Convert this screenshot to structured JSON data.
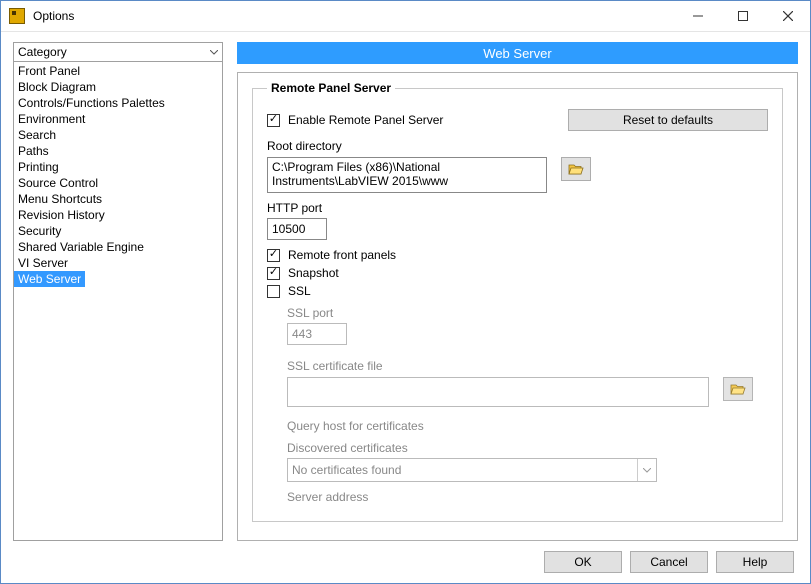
{
  "window": {
    "title": "Options"
  },
  "category": {
    "header": "Category",
    "items": [
      "Front Panel",
      "Block Diagram",
      "Controls/Functions Palettes",
      "Environment",
      "Search",
      "Paths",
      "Printing",
      "Source Control",
      "Menu Shortcuts",
      "Revision History",
      "Security",
      "Shared Variable Engine",
      "VI Server",
      "Web Server"
    ],
    "selected_index": 13
  },
  "pane": {
    "title": "Web Server",
    "group_title": "Remote Panel Server",
    "enable_label": "Enable Remote Panel Server",
    "enable_checked": true,
    "reset_label": "Reset to defaults",
    "root_dir_label": "Root directory",
    "root_dir_value": "C:\\Program Files (x86)\\National Instruments\\LabVIEW 2015\\www",
    "http_port_label": "HTTP port",
    "http_port_value": "10500",
    "remote_panels_label": "Remote front panels",
    "remote_panels_checked": true,
    "snapshot_label": "Snapshot",
    "snapshot_checked": true,
    "ssl_label": "SSL",
    "ssl_checked": false,
    "ssl_port_label": "SSL port",
    "ssl_port_value": "443",
    "ssl_cert_label": "SSL certificate file",
    "query_host_label": "Query host for certificates",
    "discovered_label": "Discovered certificates",
    "discovered_value": "No certificates found",
    "server_address_label": "Server address"
  },
  "footer": {
    "ok": "OK",
    "cancel": "Cancel",
    "help": "Help"
  }
}
